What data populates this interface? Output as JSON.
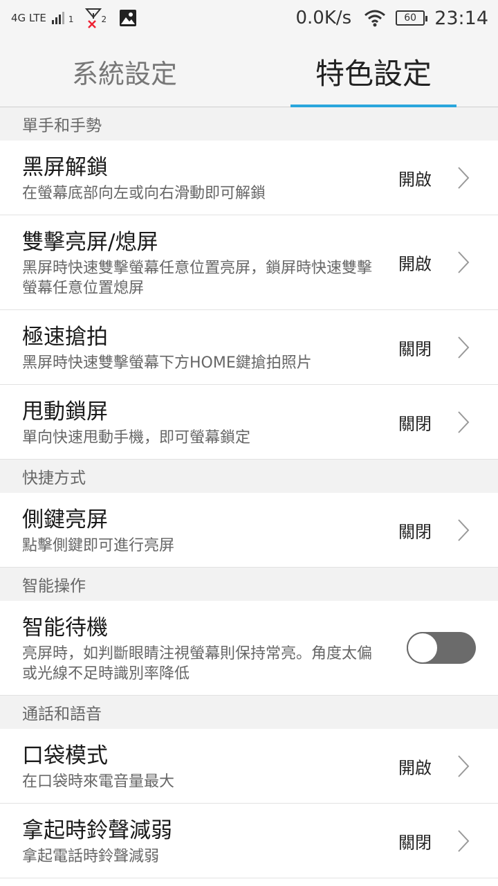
{
  "status_bar": {
    "network": "4G LTE",
    "sim1": "1",
    "sim2": "2",
    "speed": "0.0K/s",
    "battery": "60",
    "time": "23:14"
  },
  "tabs": [
    {
      "label": "系統設定",
      "active": false
    },
    {
      "label": "特色設定",
      "active": true
    }
  ],
  "sections": [
    {
      "header": "單手和手勢",
      "items": [
        {
          "title": "黑屏解鎖",
          "desc": "在螢幕底部向左或向右滑動即可解鎖",
          "value": "開啟"
        },
        {
          "title": "雙擊亮屏/熄屏",
          "desc": "黑屏時快速雙擊螢幕任意位置亮屏，鎖屏時快速雙擊螢幕任意位置熄屏",
          "value": "開啟"
        },
        {
          "title": "極速搶拍",
          "desc": "黑屏時快速雙擊螢幕下方HOME鍵搶拍照片",
          "value": "關閉"
        },
        {
          "title": "甩動鎖屏",
          "desc": "單向快速甩動手機，即可螢幕鎖定",
          "value": "關閉"
        }
      ]
    },
    {
      "header": "快捷方式",
      "items": [
        {
          "title": "側鍵亮屏",
          "desc": "點擊側鍵即可進行亮屏",
          "value": "關閉"
        }
      ]
    },
    {
      "header": "智能操作",
      "items": [
        {
          "title": "智能待機",
          "desc": "亮屏時，如判斷眼睛注視螢幕則保持常亮。角度太偏或光線不足時識別率降低",
          "toggle": false
        }
      ]
    },
    {
      "header": "通話和語音",
      "items": [
        {
          "title": "口袋模式",
          "desc": "在口袋時來電音量最大",
          "value": "開啟"
        },
        {
          "title": "拿起時鈴聲減弱",
          "desc": "拿起電話時鈴聲減弱",
          "value": "關閉"
        }
      ]
    }
  ]
}
